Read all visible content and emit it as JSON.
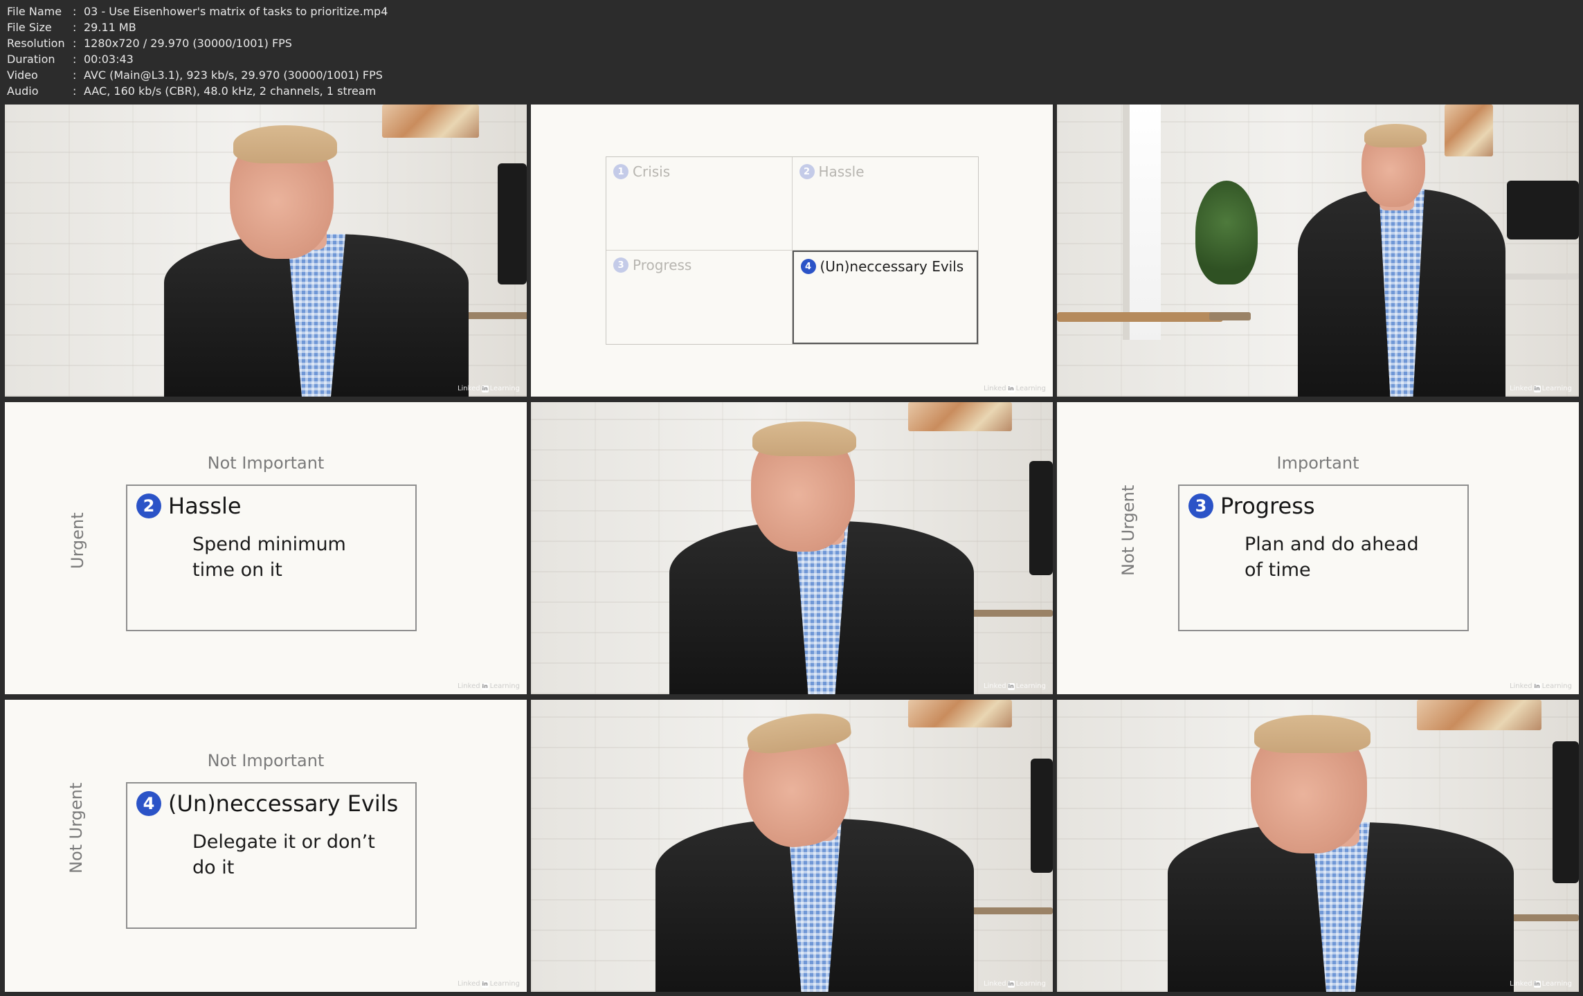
{
  "meta": {
    "rows": [
      {
        "key": "File Name",
        "value": "03 - Use Eisenhower's matrix of tasks to prioritize.mp4"
      },
      {
        "key": "File Size",
        "value": "29.11 MB"
      },
      {
        "key": "Resolution",
        "value": "1280x720 / 29.970 (30000/1001) FPS"
      },
      {
        "key": "Duration",
        "value": "00:03:43"
      },
      {
        "key": "Video",
        "value": "AVC (Main@L3.1), 923 kb/s, 29.970 (30000/1001) FPS"
      },
      {
        "key": "Audio",
        "value": "AAC, 160 kb/s (CBR), 48.0 kHz, 2 channels, 1 stream"
      }
    ],
    "sep": ":"
  },
  "brand": {
    "a": "Linked",
    "in": "in",
    "b": "Learning"
  },
  "matrix": {
    "q1": {
      "num": "1",
      "label": "Crisis"
    },
    "q2": {
      "num": "2",
      "label": "Hassle"
    },
    "q3": {
      "num": "3",
      "label": "Progress"
    },
    "q4": {
      "num": "4",
      "label": "(Un)neccessary Evils"
    }
  },
  "slide_hassle": {
    "top": "Not Important",
    "side": "Urgent",
    "num": "2",
    "title": "Hassle",
    "line1": "Spend minimum",
    "line2": "time on it"
  },
  "slide_progress": {
    "top": "Important",
    "side": "Not Urgent",
    "num": "3",
    "title": "Progress",
    "line1": "Plan and do ahead",
    "line2": "of time"
  },
  "slide_evils": {
    "top": "Not Important",
    "side": "Not Urgent",
    "num": "4",
    "title": "(Un)neccessary Evils",
    "line1": "Delegate it or don’t",
    "line2": "do it"
  },
  "colors": {
    "accent": "#2b53c7",
    "background": "#2c2c2c",
    "slide": "#faf9f5"
  }
}
